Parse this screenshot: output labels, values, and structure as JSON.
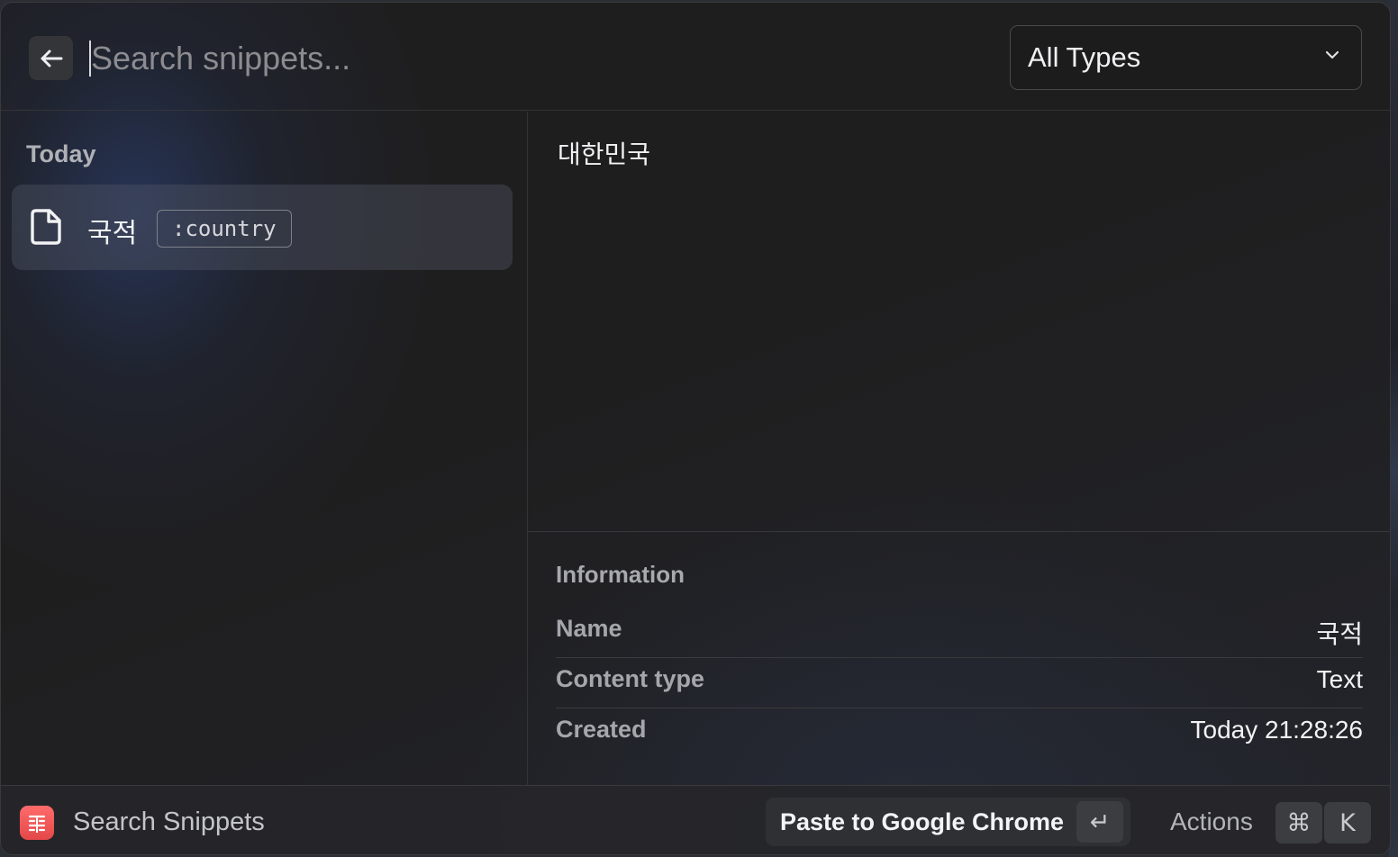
{
  "search": {
    "placeholder": "Search snippets...",
    "value": ""
  },
  "type_filter": {
    "selected": "All Types"
  },
  "list": {
    "section_header": "Today",
    "items": [
      {
        "name": "국적",
        "keyword": ":country",
        "icon": "document-icon"
      }
    ]
  },
  "preview": {
    "content": "대한민국"
  },
  "information": {
    "title": "Information",
    "rows": [
      {
        "label": "Name",
        "value": "국적"
      },
      {
        "label": "Content type",
        "value": "Text"
      },
      {
        "label": "Created",
        "value": "Today 21:28:26"
      }
    ]
  },
  "footer": {
    "title": "Search Snippets",
    "primary_action": "Paste to Google Chrome",
    "enter_key": "↵",
    "actions_label": "Actions",
    "cmd_key": "⌘",
    "k_key": "K"
  },
  "colors": {
    "window_bg": "#1f1e1f",
    "selected_item_bg": "#3b3f49",
    "app_icon": "#e44848"
  }
}
